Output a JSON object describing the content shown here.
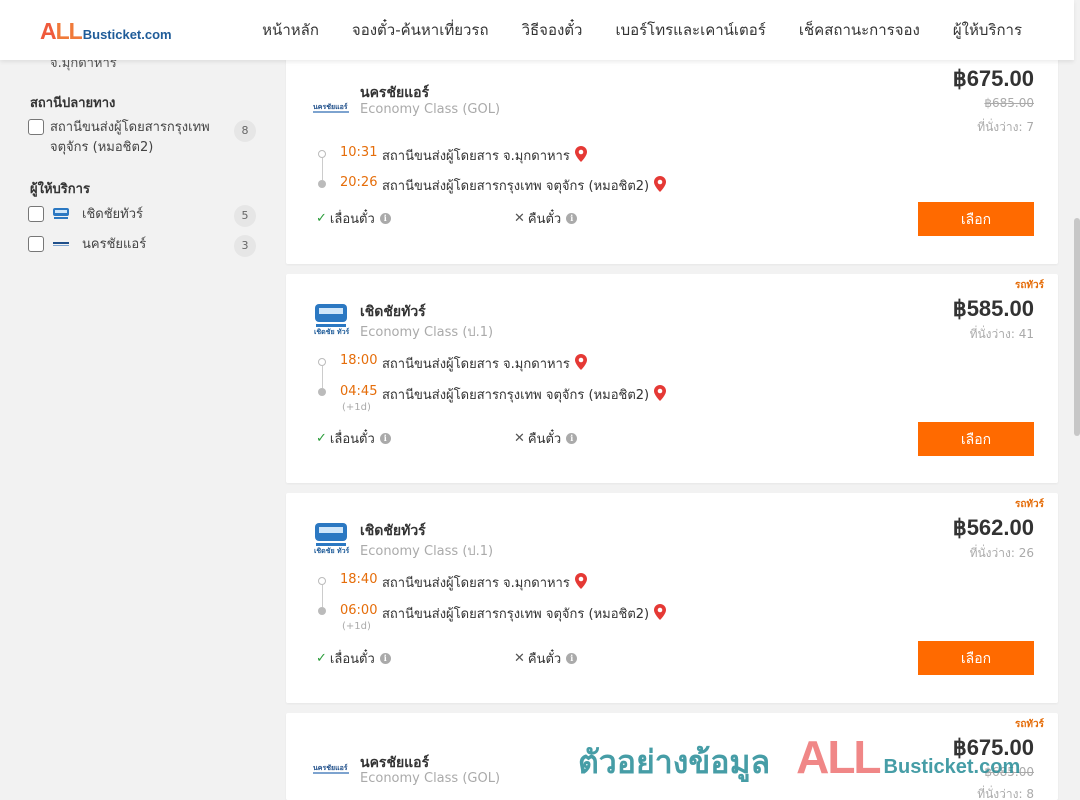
{
  "header": {
    "logo_all": "ALL",
    "logo_rest": "Busticket.com",
    "nav": [
      "หน้าหลัก",
      "จองตั๋ว-ค้นหาเที่ยวรถ",
      "วิธีจองตั๋ว",
      "เบอร์โทรและเคาน์เตอร์",
      "เช็คสถานะการจอง",
      "ผู้ให้บริการ"
    ]
  },
  "sidebar": {
    "cut_text": "จ.มุกดาหาร",
    "destination_title": "สถานีปลายทาง",
    "destinations": [
      {
        "label": "สถานีขนส่งผู้โดยสารกรุงเทพ จตุจักร (หมอชิต2)",
        "count": "8"
      }
    ],
    "operators_title": "ผู้ให้บริการ",
    "operators": [
      {
        "label": "เชิดชัยทัวร์",
        "count": "5",
        "icon": "cherdchai-logo-icon"
      },
      {
        "label": "นครชัยแอร์",
        "count": "3",
        "icon": "nakhonchai-logo-icon"
      }
    ]
  },
  "trips": [
    {
      "tag": "",
      "operator": "นครชัยแอร์",
      "operator_icon": "nakhonchai-logo-icon",
      "class": "Economy Class (GOL)",
      "price": "฿675.00",
      "old_price": "฿685.00",
      "seats": "ที่นั่งว่าง: 7",
      "depart_time": "10:31",
      "depart_station": "สถานีขนส่งผู้โดยสาร จ.มุกดาหาร",
      "arrive_time": "20:26",
      "arrive_next_day": "",
      "arrive_station": "สถานีขนส่งผู้โดยสารกรุงเทพ จตุจักร (หมอชิต2)",
      "change_label": "เลื่อนตั๋ว",
      "refund_label": "คืนตั๋ว",
      "select_label": "เลือก"
    },
    {
      "tag": "รถทัวร์",
      "operator": "เชิดชัยทัวร์",
      "operator_icon": "cherdchai-logo-icon",
      "class": "Economy Class (ป.1)",
      "price": "฿585.00",
      "old_price": "",
      "seats": "ที่นั่งว่าง: 41",
      "depart_time": "18:00",
      "depart_station": "สถานีขนส่งผู้โดยสาร จ.มุกดาหาร",
      "arrive_time": "04:45",
      "arrive_next_day": "(+1d)",
      "arrive_station": "สถานีขนส่งผู้โดยสารกรุงเทพ จตุจักร (หมอชิต2)",
      "change_label": "เลื่อนตั๋ว",
      "refund_label": "คืนตั๋ว",
      "select_label": "เลือก"
    },
    {
      "tag": "รถทัวร์",
      "operator": "เชิดชัยทัวร์",
      "operator_icon": "cherdchai-logo-icon",
      "class": "Economy Class (ป.1)",
      "price": "฿562.00",
      "old_price": "",
      "seats": "ที่นั่งว่าง: 26",
      "depart_time": "18:40",
      "depart_station": "สถานีขนส่งผู้โดยสาร จ.มุกดาหาร",
      "arrive_time": "06:00",
      "arrive_next_day": "(+1d)",
      "arrive_station": "สถานีขนส่งผู้โดยสารกรุงเทพ จตุจักร (หมอชิต2)",
      "change_label": "เลื่อนตั๋ว",
      "refund_label": "คืนตั๋ว",
      "select_label": "เลือก"
    },
    {
      "tag": "รถทัวร์",
      "operator": "นครชัยแอร์",
      "operator_icon": "nakhonchai-logo-icon",
      "class": "Economy Class (GOL)",
      "price": "฿675.00",
      "old_price": "฿685.00",
      "seats": "ที่นั่งว่าง: 8"
    }
  ],
  "watermark": {
    "text": "ตัวอย่างข้อมูล",
    "all": "ALL",
    "rest": "Busticket.com"
  },
  "colors": {
    "accent": "#ff6a00",
    "time": "#e56d0a",
    "pin": "#e53935",
    "ok": "#2a9d3a"
  }
}
